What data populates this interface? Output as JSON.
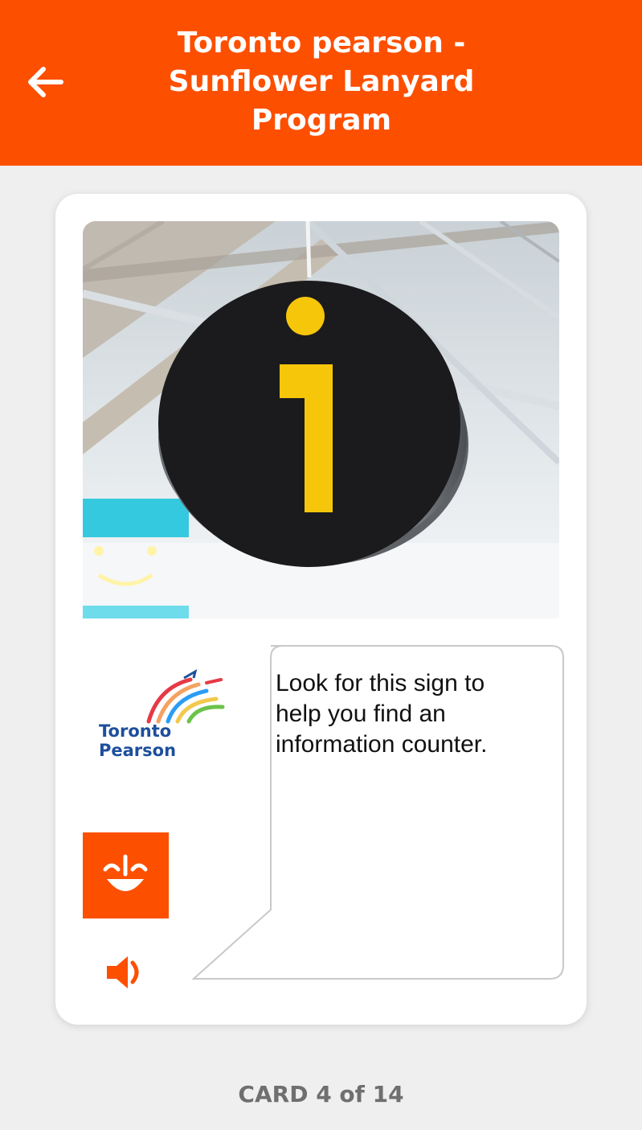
{
  "header": {
    "title_line1": "Toronto pearson -",
    "title_line2": "Sunflower Lanyard",
    "title_line3": "Program",
    "back_icon": "arrow-left-icon",
    "bg_color": "#fd4f00"
  },
  "card": {
    "photo_icon": "information-sign-photo",
    "logo": {
      "line1": "Toronto",
      "line2": "Pearson"
    },
    "speech_text_line1": "Look for this sign to",
    "speech_text_line2": "help you find an",
    "speech_text_line3": "information counter.",
    "avatar_icon": "smiling-face-icon",
    "speaker_icon": "speaker-icon"
  },
  "footer": {
    "counter": "CARD 4 of 14"
  }
}
